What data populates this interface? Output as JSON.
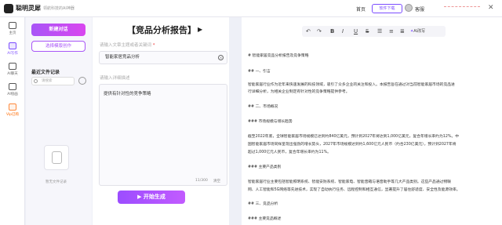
{
  "topbar": {
    "brand": "聪明灵犀",
    "slogan": "领航科技的AI神器",
    "home": "首页",
    "download": "软件下载",
    "user": "客服"
  },
  "nav": [
    {
      "label": "主页",
      "icon": "home-icon"
    },
    {
      "label": "AI写作",
      "icon": "pen-icon"
    },
    {
      "label": "AI聊天",
      "icon": "chat-icon"
    },
    {
      "label": "AI绘画",
      "icon": "paint-icon"
    },
    {
      "label": "Vip已购",
      "icon": "vip-icon"
    }
  ],
  "files": {
    "new_button": "新建对话",
    "template_button": "选择模版创作",
    "recent_title": "最近文件记录",
    "search_placeholder": "请搜索",
    "empty_text": "暂无文件记录"
  },
  "editor": {
    "title": "【竞品分析报告】",
    "topic_hint": "请输入文章主题或者关键词",
    "topic_required": "*",
    "topic_value": "智能家居竞品分析",
    "detail_hint": "请输入详细描述",
    "detail_value": "提供有针对性的竞争策略",
    "char_count": "11/300",
    "clear": "清空",
    "generate": "开始生成"
  },
  "toolbar": {
    "undo": "↶",
    "redo": "↷",
    "bold": "B",
    "italic": "I",
    "underline": "U",
    "strike": "S",
    "ai_label": "AI改写"
  },
  "output_lines": [
    "# 智能家居竞品分析报告及竞争策略",
    "## 一、引言",
    "智能家居行业作为近年来快速发展的科技领域，吸引了众多企业的关注和投入。本报告旨在通过对当前智能家居市场的竞品进",
    "行详细分析，为相关企业制定有针对性的竞争策略提供参考。",
    "## 二、市场概况",
    "### 市场规模与增长趋势",
    "截至2022年底，全球智能家居市场规模已达到约840亿美元，预计到2027年将达到1,000亿美元，复合年增长率约为12%。中",
    "国智能家居市场同样呈现出强劲的增长势头，2027年市场规模达到约1,600亿元人民币（约合230亿美元），预计到2027年将",
    "超过1,000亿元人民币，复合年增长率约为11%。",
    "### 主要产品类别",
    "智能家居行业主要包括智能照明系统、智能安防系统、智能家电、智能音箱与语音助手等几大产品类别。这些产品通过物联",
    "网、人工智能和5G网络等先进技术，实现了自动执行任务、远程控制和相互通信，显著提升了居住舒适度、安全性及能源效率。",
    "## 三、竞品分析",
    "### 主要竞品概述"
  ]
}
